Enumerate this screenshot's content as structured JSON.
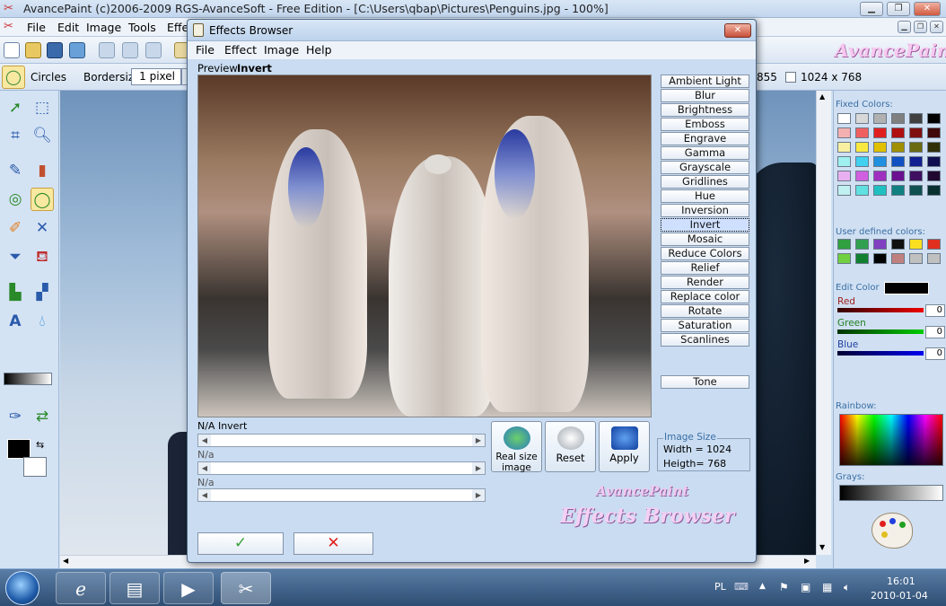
{
  "app": {
    "title": "AvancePaint (c)2006-2009 RGS-AvanceSoft - Free Edition - [C:\\Users\\qbap\\Pictures\\Penguins.jpg - 100%]",
    "logo": "AvancePaint",
    "menu": [
      "File",
      "Edit",
      "Image",
      "Tools",
      "Effe"
    ]
  },
  "toolbar2": {
    "tool_name": "Circles",
    "bordersize_label": "Bordersize:",
    "bordersize_value": "1 pixel",
    "coord_partial": "855",
    "image_dims": "1024 x 768"
  },
  "right_panel": {
    "fixed_colors_label": "Fixed Colors:",
    "user_colors_label": "User defined colors:",
    "edit_color_label": "Edit Color",
    "red_label": "Red",
    "red_value": "0",
    "green_label": "Green",
    "green_value": "0",
    "blue_label": "Blue",
    "blue_value": "0",
    "rainbow_label": "Rainbow:",
    "grays_label": "Grays:",
    "fixed_colors": [
      "#ffffff",
      "#d8d8d8",
      "#b0b0b0",
      "#808080",
      "#404040",
      "#000000",
      "#f4b0b0",
      "#f06060",
      "#e02020",
      "#b01010",
      "#801010",
      "#400808",
      "#f8f0a0",
      "#f8e840",
      "#e0c000",
      "#a09000",
      "#6a6a10",
      "#303008",
      "#a0f0f0",
      "#40d0f0",
      "#2090e0",
      "#1050c0",
      "#102090",
      "#101050",
      "#e8b0f0",
      "#d060e0",
      "#a030c0",
      "#6a1090",
      "#401060",
      "#200830",
      "#c0f0f0",
      "#60e0e0",
      "#20c0c0",
      "#108080",
      "#105050",
      "#083030"
    ],
    "user_colors": [
      "#30a040",
      "#30a050",
      "#8040c0",
      "#101010",
      "#f8e020",
      "#e03020",
      "#70d040",
      "#108030",
      "#000000",
      "#c08080",
      "#c0c0c0",
      "#c0c0c0"
    ]
  },
  "taskbar": {
    "lang": "PL",
    "time": "16:01",
    "date": "2010-01-04"
  },
  "dialog": {
    "title": "Effects Browser",
    "menu": [
      "File",
      "Effect",
      "Image",
      "Help"
    ],
    "preview_label": "Preview",
    "preview_effect": "Invert",
    "effects": [
      "Ambient Light",
      "Blur",
      "Brightness",
      "Emboss",
      "Engrave",
      "Gamma",
      "Grayscale",
      "Gridlines",
      "Hue",
      "Inversion",
      "Invert",
      "Mosaic",
      "Reduce Colors",
      "Relief",
      "Render",
      "Replace color",
      "Rotate",
      "Saturation",
      "Scanlines"
    ],
    "selected_effect": "Invert",
    "tone_button": "Tone",
    "slider1_label": "N/A Invert",
    "slider2_label": "N/a",
    "slider3_label": "N/a",
    "real_size_button": "Real size image",
    "reset_button": "Reset",
    "apply_button": "Apply",
    "image_size_label": "Image Size",
    "width_text": "Width = 1024",
    "height_text": "Heigth= 768",
    "brand_line1": "AvancePaint",
    "brand_line2": "Effects Browser"
  }
}
